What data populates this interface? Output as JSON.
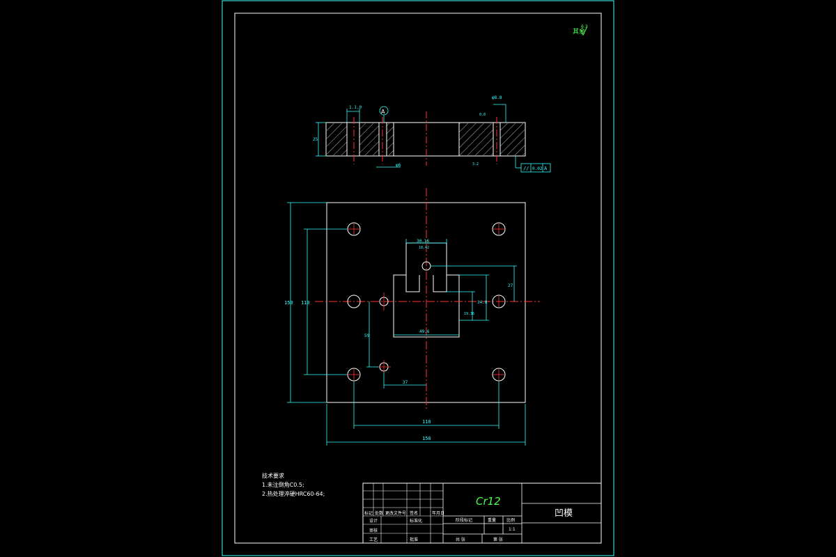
{
  "roughness_note": {
    "label": "其余",
    "value": "6.3"
  },
  "section_view": {
    "datum_label": "A",
    "width_dim": "1.1.0",
    "hole_dim": "φ6",
    "thickness_dim": "25",
    "tolerance_frame": {
      "symbol": "//",
      "value": "0.02",
      "datum": "A"
    },
    "roughness_top": "0.8",
    "roughness_bottom": "3.2",
    "counterbore_note": "φ8.8"
  },
  "plan_view": {
    "overall_width": "150",
    "hole_spacing_x": "110",
    "overall_height": "150",
    "hole_spacing_y": "110",
    "cavity_top_width": "30.16",
    "cavity_top_sub": "18.42",
    "cavity_width": "49.6",
    "cavity_height": "14.8",
    "cavity_depth": "19.36",
    "offset_right": "27",
    "pilot_offset_y": "59",
    "pilot_offset_x": "37"
  },
  "tech_requirements": {
    "title": "技术要求",
    "items": [
      "1.未注倒角C0.5;",
      "2.热处理淬硬HRC60-64;"
    ]
  },
  "title_block": {
    "material": "Cr12",
    "part_name": "凹模",
    "labels": {
      "mark": "标记",
      "count": "处数",
      "zone": "分区",
      "change_doc": "更改文件号",
      "sign": "签名",
      "date": "年月日",
      "design": "设计",
      "standardize": "标准化",
      "review": "审核",
      "process": "工艺",
      "approve": "批准",
      "stage_mark": "阶段标记",
      "weight": "重量",
      "scale": "比例",
      "sheet_total": "共 张",
      "sheet_no": "第 张",
      "scale_value": "1:1"
    }
  }
}
